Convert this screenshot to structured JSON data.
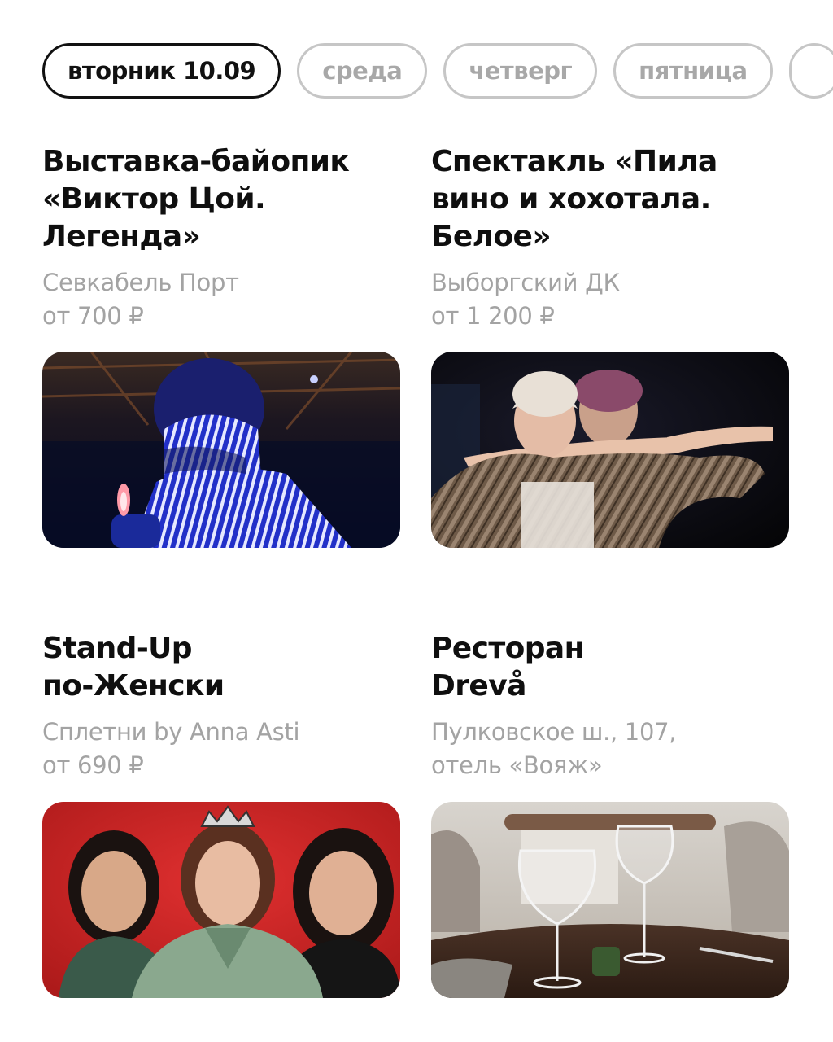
{
  "day_tabs": [
    {
      "label": "вторник 10.09",
      "active": true
    },
    {
      "label": "среда",
      "active": false
    },
    {
      "label": "четверг",
      "active": false
    },
    {
      "label": "пятница",
      "active": false
    }
  ],
  "events": [
    {
      "title": "Выставка-байопик\n«Виктор Цой.\nЛегенда»",
      "venue": "Севкабель Порт",
      "price": "от 700 ₽"
    },
    {
      "title": "Спектакль «Пила\nвино и хохотала.\nБелое»",
      "venue": "Выборгский ДК",
      "price": "от 1 200 ₽"
    },
    {
      "title": "Stand-Up\nпо-Женски",
      "venue": "Сплетни by Anna Asti",
      "price": "от 690 ₽"
    },
    {
      "title": "Ресторан\nDrevå",
      "venue": "Пулковское ш., 107,\nотель «Вояж»",
      "price": ""
    }
  ]
}
